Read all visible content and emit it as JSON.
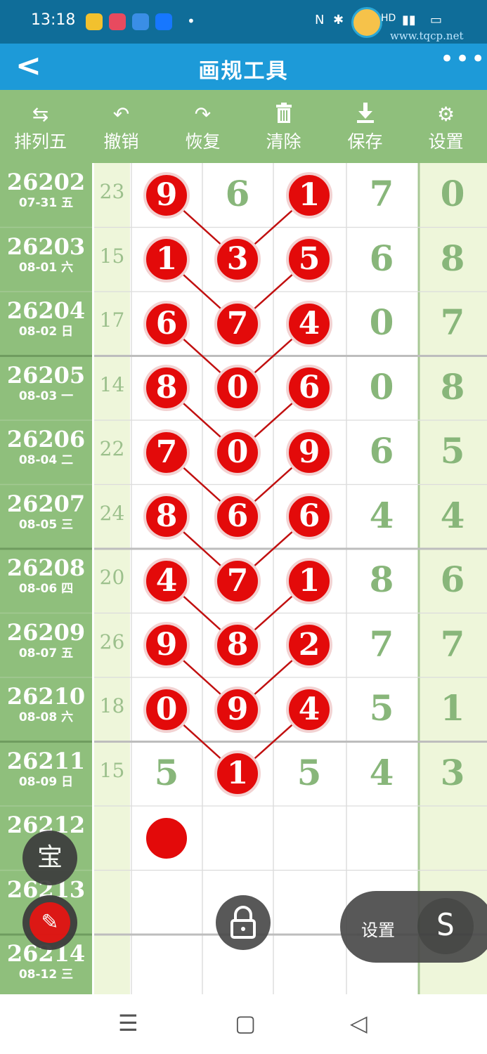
{
  "status": {
    "time": "13:18",
    "watermark": "www.tqcp.net"
  },
  "header": {
    "back_icon": "chevron-left-icon",
    "title": "画规工具",
    "more_icon": "more-dots-icon"
  },
  "toolbar": {
    "items": [
      {
        "label": "排列五",
        "icon": "swap-icon"
      },
      {
        "label": "撤销",
        "icon": "undo-icon"
      },
      {
        "label": "恢复",
        "icon": "redo-icon"
      },
      {
        "label": "清除",
        "icon": "trash-icon"
      },
      {
        "label": "保存",
        "icon": "download-icon"
      },
      {
        "label": "设置",
        "icon": "gear-icon"
      }
    ]
  },
  "rows": [
    {
      "period": "26202",
      "date": "07-31 五",
      "sum": "23",
      "digits": [
        "9",
        "6",
        "1",
        "7",
        "0"
      ],
      "circled": [
        0,
        2
      ]
    },
    {
      "period": "26203",
      "date": "08-01 六",
      "sum": "15",
      "digits": [
        "1",
        "3",
        "5",
        "6",
        "8"
      ],
      "circled": [
        0,
        1,
        2
      ]
    },
    {
      "period": "26204",
      "date": "08-02 日",
      "sum": "17",
      "digits": [
        "6",
        "7",
        "4",
        "0",
        "7"
      ],
      "circled": [
        0,
        1,
        2
      ]
    },
    {
      "period": "26205",
      "date": "08-03 一",
      "sum": "14",
      "digits": [
        "8",
        "0",
        "6",
        "0",
        "8"
      ],
      "circled": [
        0,
        1,
        2
      ]
    },
    {
      "period": "26206",
      "date": "08-04 二",
      "sum": "22",
      "digits": [
        "7",
        "0",
        "9",
        "6",
        "5"
      ],
      "circled": [
        0,
        1,
        2
      ]
    },
    {
      "period": "26207",
      "date": "08-05 三",
      "sum": "24",
      "digits": [
        "8",
        "6",
        "6",
        "4",
        "4"
      ],
      "circled": [
        0,
        1,
        2
      ]
    },
    {
      "period": "26208",
      "date": "08-06 四",
      "sum": "20",
      "digits": [
        "4",
        "7",
        "1",
        "8",
        "6"
      ],
      "circled": [
        0,
        1,
        2
      ]
    },
    {
      "period": "26209",
      "date": "08-07 五",
      "sum": "26",
      "digits": [
        "9",
        "8",
        "2",
        "7",
        "7"
      ],
      "circled": [
        0,
        1,
        2
      ]
    },
    {
      "period": "26210",
      "date": "08-08 六",
      "sum": "18",
      "digits": [
        "0",
        "9",
        "4",
        "5",
        "1"
      ],
      "circled": [
        0,
        1,
        2
      ]
    },
    {
      "period": "26211",
      "date": "08-09 日",
      "sum": "15",
      "digits": [
        "5",
        "1",
        "5",
        "4",
        "3"
      ],
      "circled": [
        1
      ]
    },
    {
      "period": "26212",
      "date": "",
      "sum": "",
      "digits": [
        "",
        "",
        "",
        "",
        ""
      ],
      "circled": [],
      "marker_col": 0
    },
    {
      "period": "26213",
      "date": "",
      "sum": "",
      "digits": [
        "",
        "",
        "",
        "",
        ""
      ],
      "circled": []
    },
    {
      "period": "26214",
      "date": "08-12 三",
      "sum": "",
      "digits": [
        "",
        "",
        "",
        "",
        ""
      ],
      "circled": []
    }
  ],
  "floating": {
    "bao_label": "宝",
    "pen_icon": "signature-pen-icon",
    "lock_icon": "lock-icon",
    "settings_label": "设置",
    "s_icon": "s-logo-icon"
  },
  "navbar": {
    "menu_icon": "menu-icon",
    "home_icon": "home-square-icon",
    "back_icon": "back-triangle-icon"
  },
  "colors": {
    "ball": "#e30a0a",
    "leftcol": "#8fbf7c",
    "header": "#1d9ad8",
    "digit": "#88b67a",
    "line": "#c11010"
  }
}
